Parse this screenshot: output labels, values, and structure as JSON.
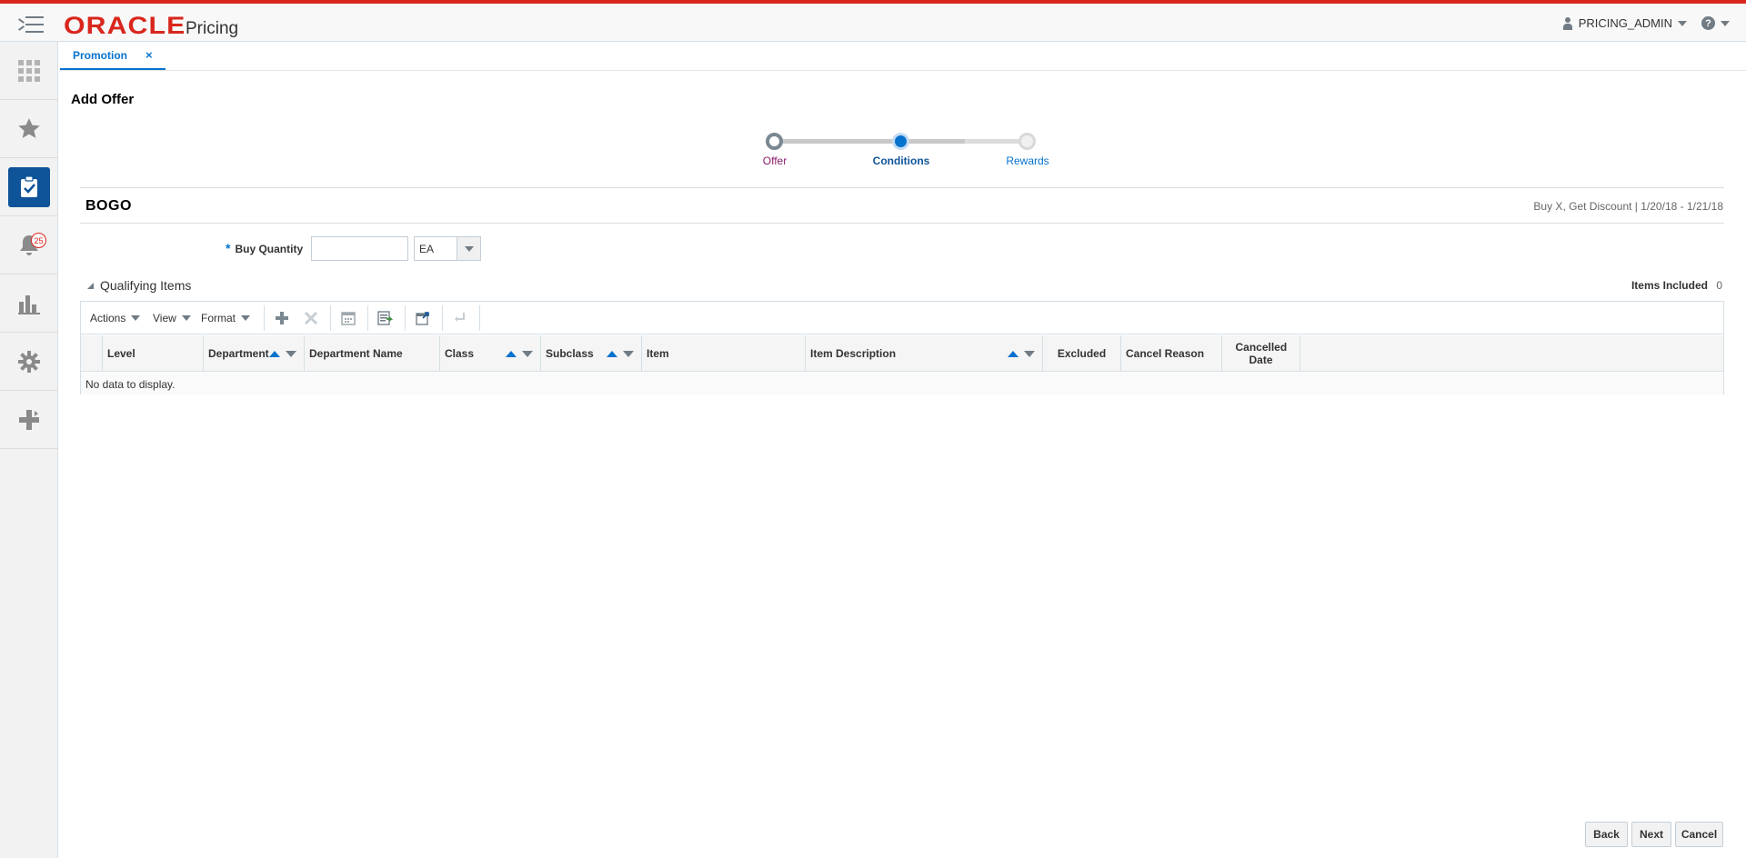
{
  "header": {
    "brand": "ORACLE",
    "app_name": "Pricing",
    "user": "PRICING_ADMIN",
    "help_glyph": "?",
    "accent_color": "#d9261c"
  },
  "sidenav": {
    "items": [
      {
        "name": "tasks-grid-icon"
      },
      {
        "name": "favorites-star-icon"
      },
      {
        "name": "task-list-icon",
        "active": true
      },
      {
        "name": "notifications-bell-icon",
        "badge": "25"
      },
      {
        "name": "reports-chart-icon"
      },
      {
        "name": "settings-gear-icon"
      },
      {
        "name": "create-plus-icon"
      }
    ]
  },
  "tabs": [
    {
      "label": "Promotion",
      "close": "×"
    }
  ],
  "page": {
    "title": "Add Offer"
  },
  "train": {
    "stops": [
      {
        "label": "Offer",
        "state": "visited",
        "color": "#8b1a6b"
      },
      {
        "label": "Conditions",
        "state": "current",
        "color": "#0f5499"
      },
      {
        "label": "Rewards",
        "state": "unvisited",
        "color": "#0572ce"
      }
    ]
  },
  "offer": {
    "name": "BOGO",
    "meta": "Buy X, Get Discount |  1/20/18  -  1/21/18"
  },
  "form": {
    "required_mark": "*",
    "buy_quantity_label": "Buy Quantity",
    "buy_quantity_value": "",
    "uom_value": "EA"
  },
  "qualifying": {
    "title": "Qualifying Items",
    "items_included_label": "Items Included",
    "items_included_count": "0"
  },
  "toolbar": {
    "menus": [
      "Actions",
      "View",
      "Format"
    ]
  },
  "table": {
    "columns": [
      "Level",
      "Department",
      "Department Name",
      "Class",
      "Subclass",
      "Item",
      "Item Description",
      "Excluded",
      "Cancel Reason",
      "Cancelled Date"
    ],
    "empty_text": "No data to display."
  },
  "footer": {
    "back": "Back",
    "next": "Next",
    "cancel": "Cancel"
  }
}
